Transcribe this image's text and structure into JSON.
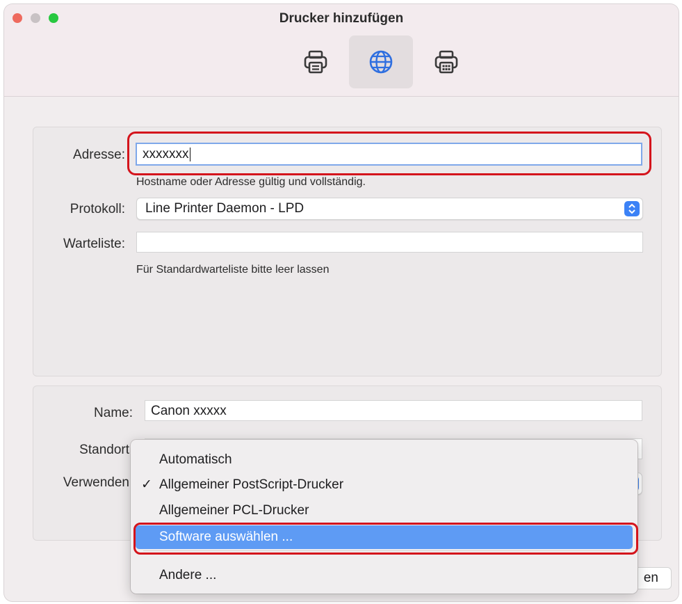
{
  "window": {
    "title": "Drucker hinzufügen"
  },
  "toolbar": {
    "items": [
      {
        "icon": "printer-icon",
        "active": false
      },
      {
        "icon": "globe-icon",
        "active": true
      },
      {
        "icon": "printer-server-icon",
        "active": false
      }
    ]
  },
  "connection": {
    "address_label": "Adresse:",
    "address_value": "xxxxxxx",
    "address_hint": "Hostname oder Adresse gültig und vollständig.",
    "protocol_label": "Protokoll:",
    "protocol_value": "Line Printer Daemon - LPD",
    "queue_label": "Warteliste:",
    "queue_value": "",
    "queue_hint": "Für Standardwarteliste bitte leer lassen"
  },
  "details": {
    "name_label": "Name:",
    "name_value": "Canon xxxxx",
    "location_label": "Standort",
    "use_label": "Verwenden"
  },
  "driver_menu": {
    "items": [
      {
        "label": "Automatisch",
        "checked": false,
        "highlighted": false
      },
      {
        "label": "Allgemeiner PostScript-Drucker",
        "checked": true,
        "highlighted": false
      },
      {
        "label": "Allgemeiner PCL-Drucker",
        "checked": false,
        "highlighted": false
      },
      {
        "label": "Software auswählen ...",
        "checked": false,
        "highlighted": true
      },
      {
        "label": "Andere ...",
        "checked": false,
        "highlighted": false
      }
    ],
    "check_glyph": "✓"
  },
  "footer": {
    "add_button_partial": "en"
  },
  "colors": {
    "accent": "#3c82f6",
    "highlight": "#5e9bf4",
    "annotation": "#d4141c"
  }
}
